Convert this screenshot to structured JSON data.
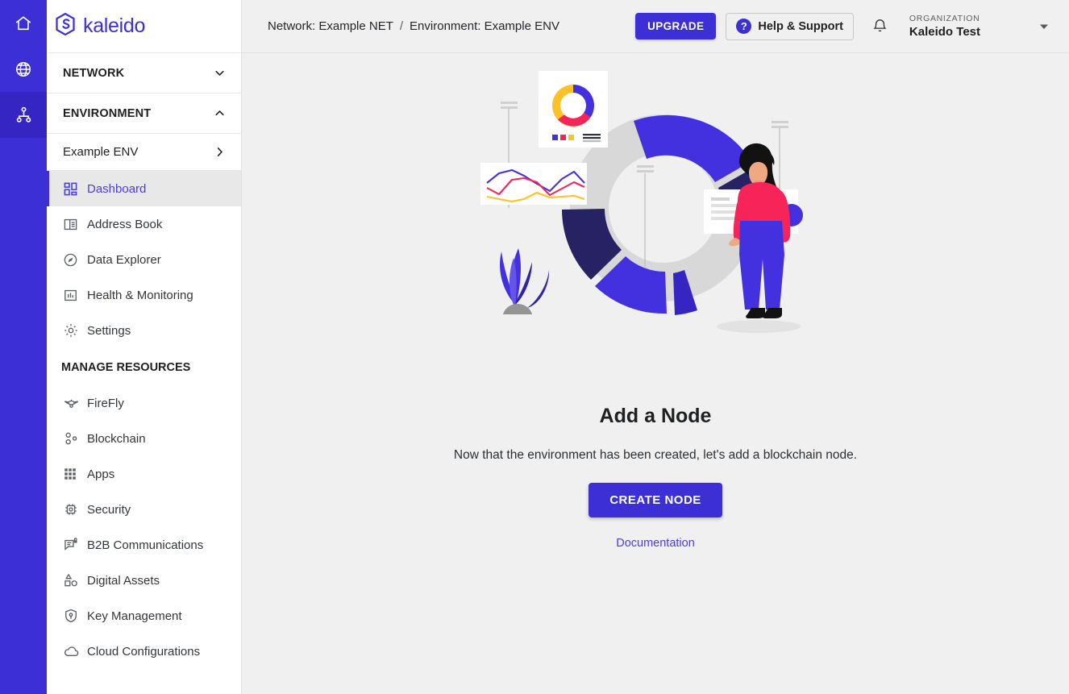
{
  "brand": {
    "name": "kaleido",
    "logo_icon": "kaleido-hex-logo-icon"
  },
  "rail": {
    "items": [
      {
        "icon": "home-icon",
        "name": "home",
        "active": false
      },
      {
        "icon": "globe-icon",
        "name": "networks",
        "active": false
      },
      {
        "icon": "sitemap-icon",
        "name": "environments",
        "active": true
      }
    ]
  },
  "sidebar": {
    "sections": [
      {
        "label": "NETWORK",
        "icon": "chevron-down-icon",
        "expanded": false
      },
      {
        "label": "ENVIRONMENT",
        "icon": "chevron-up-icon",
        "expanded": true
      }
    ],
    "env_row": {
      "label": "Example ENV",
      "icon": "chevron-right-icon"
    },
    "nav_items": [
      {
        "label": "Dashboard",
        "icon": "dashboard-grid-icon",
        "active": true
      },
      {
        "label": "Address Book",
        "icon": "address-book-icon",
        "active": false
      },
      {
        "label": "Data Explorer",
        "icon": "compass-icon",
        "active": false
      },
      {
        "label": "Health & Monitoring",
        "icon": "bar-chart-icon",
        "active": false
      },
      {
        "label": "Settings",
        "icon": "gear-icon",
        "active": false
      }
    ],
    "group_title": "MANAGE RESOURCES",
    "resource_items": [
      {
        "label": "FireFly",
        "icon": "firefly-icon"
      },
      {
        "label": "Blockchain",
        "icon": "blockchain-nodes-icon"
      },
      {
        "label": "Apps",
        "icon": "apps-grid-icon"
      },
      {
        "label": "Security",
        "icon": "security-chip-icon"
      },
      {
        "label": "B2B Communications",
        "icon": "message-lock-icon"
      },
      {
        "label": "Digital Assets",
        "icon": "shapes-icon"
      },
      {
        "label": "Key Management",
        "icon": "shield-key-icon"
      },
      {
        "label": "Cloud Configurations",
        "icon": "cloud-icon"
      }
    ]
  },
  "topbar": {
    "breadcrumb": {
      "network": "Network: Example NET",
      "separator": "/",
      "environment": "Environment: Example ENV"
    },
    "upgrade_label": "UPGRADE",
    "help_label": "Help & Support",
    "help_badge": "?",
    "bell_icon": "notification-bell-icon",
    "org_caption": "ORGANIZATION",
    "org_name": "Kaleido Test",
    "caret_icon": "caret-down-icon"
  },
  "hero": {
    "title": "Add a Node",
    "subtitle": "Now that the environment has been created, let's add a blockchain node.",
    "create_label": "CREATE NODE",
    "documentation_label": "Documentation",
    "illustration": "analytics-dashboard-woman-illustration"
  },
  "colors": {
    "brand_purple": "#3d2fd6",
    "rail_active": "#3526c4",
    "link_purple": "#4a3ee0",
    "main_bg": "#f0f0f0",
    "sidebar_bg": "#ffffff",
    "active_nav_bg": "#e8e8e8",
    "illus_blue": "#4331e0",
    "illus_dark_navy": "#262263",
    "illus_pink": "#f62459",
    "illus_yellow": "#fdc12a",
    "illus_gray": "#d6d6d6"
  }
}
